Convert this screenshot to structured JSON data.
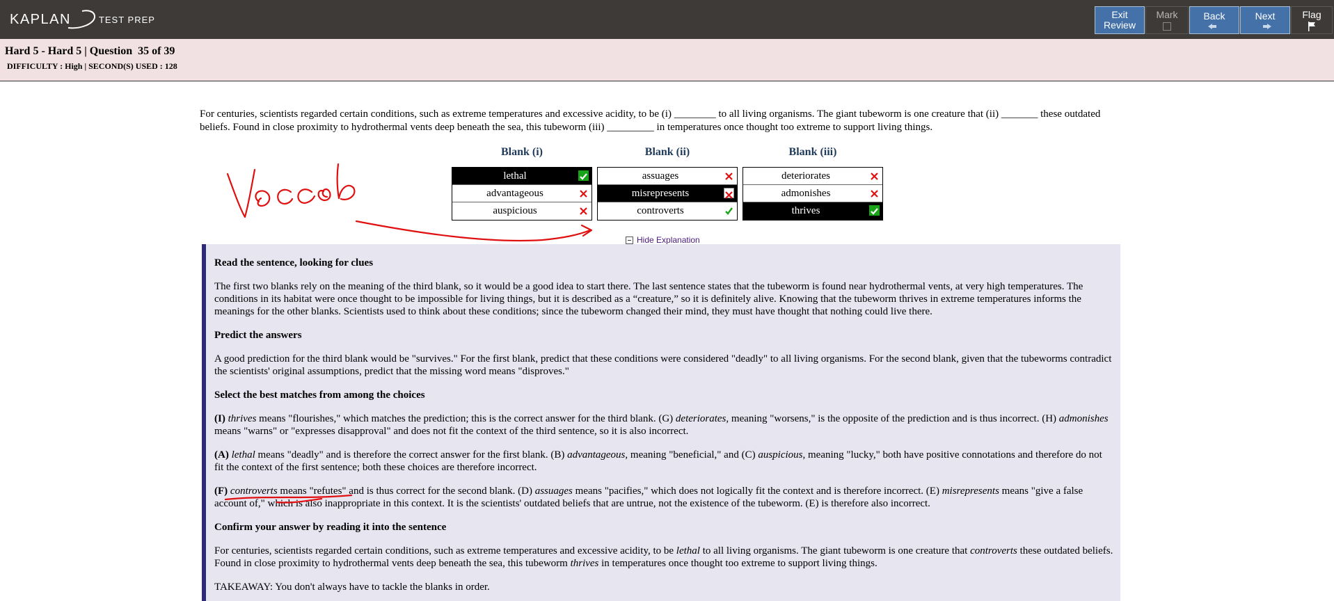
{
  "brand": {
    "name": "KAPLAN",
    "sub": "TEST PREP"
  },
  "nav": {
    "exit": "Exit Review",
    "mark": "Mark",
    "back": "Back",
    "next": "Next",
    "flag": "Flag"
  },
  "question": {
    "title": "Hard 5 - Hard 5 | Question  35 of 39",
    "meta": "DIFFICULTY : High | SECOND(S) USED : 128"
  },
  "passage": "For centuries, scientists regarded certain conditions, such as extreme temperatures and excessive acidity, to be (i) ________ to all living organisms. The giant tubeworm is one creature that (ii) _______ these outdated beliefs. Found in close proximity to hydrothermal vents deep beneath the sea, this tubeworm (iii) _________ in temperatures once thought too extreme to support living things.",
  "blanks": [
    {
      "header": "Blank (i)",
      "choices": [
        {
          "text": "lethal",
          "selected": true,
          "mark": "correct"
        },
        {
          "text": "advantageous",
          "selected": false,
          "mark": "wrong"
        },
        {
          "text": "auspicious",
          "selected": false,
          "mark": "wrong"
        }
      ]
    },
    {
      "header": "Blank (ii)",
      "choices": [
        {
          "text": "assuages",
          "selected": false,
          "mark": "wrong"
        },
        {
          "text": "misrepresents",
          "selected": true,
          "mark": "wrong"
        },
        {
          "text": "controverts",
          "selected": false,
          "mark": "correct"
        }
      ]
    },
    {
      "header": "Blank (iii)",
      "choices": [
        {
          "text": "deteriorates",
          "selected": false,
          "mark": "wrong"
        },
        {
          "text": "admonishes",
          "selected": false,
          "mark": "wrong"
        },
        {
          "text": "thrives",
          "selected": true,
          "mark": "correct"
        }
      ]
    }
  ],
  "hide_explanation": "Hide Explanation",
  "explanation": {
    "h1": "Read the sentence, looking for clues",
    "p1": "The first two blanks rely on the meaning of the third blank, so it would be a good idea to start there. The last sentence states that the tubeworm is found near hydrothermal vents, at very high temperatures. The conditions in its habitat were once thought to be impossible for living things, but it is described as a “creature,” so it is definitely alive. Knowing that the tubeworm thrives in extreme temperatures informs the meanings for the other blanks. Scientists used to think about these conditions; since the tubeworm changed their mind, they must have thought that nothing could live there.",
    "h2": "Predict the answers",
    "p2": "A good prediction for the third blank would be \"survives.\" For the first blank, predict that these conditions were considered \"deadly\" to all living organisms. For the second blank, given that the tubeworms contradict the scientists' original assumptions, predict that the missing word means \"disproves.\"",
    "h3": "Select the best matches from among the choices",
    "p3": {
      "l": "(I)",
      "w1": "thrives",
      "t1": " means \"flourishes,\" which matches the prediction; this is the correct answer for the third blank. (G) ",
      "w2": "deteriorates,",
      "t2": " meaning \"worsens,\" is the opposite of the prediction and is thus incorrect. (H) ",
      "w3": "admonishes",
      "t3": " means \"warns\" or \"expresses disapproval\" and does not fit the context of the third sentence, so it is also incorrect."
    },
    "p4": {
      "l": "(A)",
      "w1": "lethal",
      "t1": " means \"deadly\" and is therefore the correct answer for the first blank. (B) ",
      "w2": "advantageous",
      "t2": ", meaning \"beneficial,\" and (C) ",
      "w3": "auspicious",
      "t3": ", meaning \"lucky,\" both have positive connotations and therefore do not fit the context of the first sentence; both these choices are therefore incorrect."
    },
    "p5": {
      "l": "(F)",
      "w1": "controverts",
      "t1": " means \"refutes\" and is thus correct for the second blank. (D) ",
      "w2": "assuages",
      "t2": " means \"pacifies,\" which does not logically fit the context and is therefore incorrect. (E) ",
      "w3": "misrepresents",
      "t3": " means \"give a false account of,\" which is also inappropriate in this context. It is the scientists' outdated beliefs that are untrue, not the existence of the tubeworm. (E) is therefore also incorrect."
    },
    "h4": "Confirm your answer by reading it into the sentence",
    "p6": {
      "t1": "For centuries, scientists regarded certain conditions, such as extreme temperatures and excessive acidity, to be ",
      "w1": "lethal",
      "t2": " to all living organisms. The giant tubeworm is one creature that ",
      "w2": "controverts",
      "t3": " these outdated beliefs. Found in close proximity to hydrothermal vents deep beneath the sea, this tubeworm ",
      "w3": "thrives",
      "t4": " in temperatures once thought too extreme to support living things."
    },
    "takeaway": "TAKEAWAY: You don't always have to tackle the blanks in order."
  },
  "colors": {
    "topbar": "#3d3a38",
    "nav_button": "#4471a8",
    "infobar": "#f2e1e2",
    "explain_bg": "#e6e5f0",
    "explain_border": "#2e2a78",
    "ink": "#e01010"
  }
}
